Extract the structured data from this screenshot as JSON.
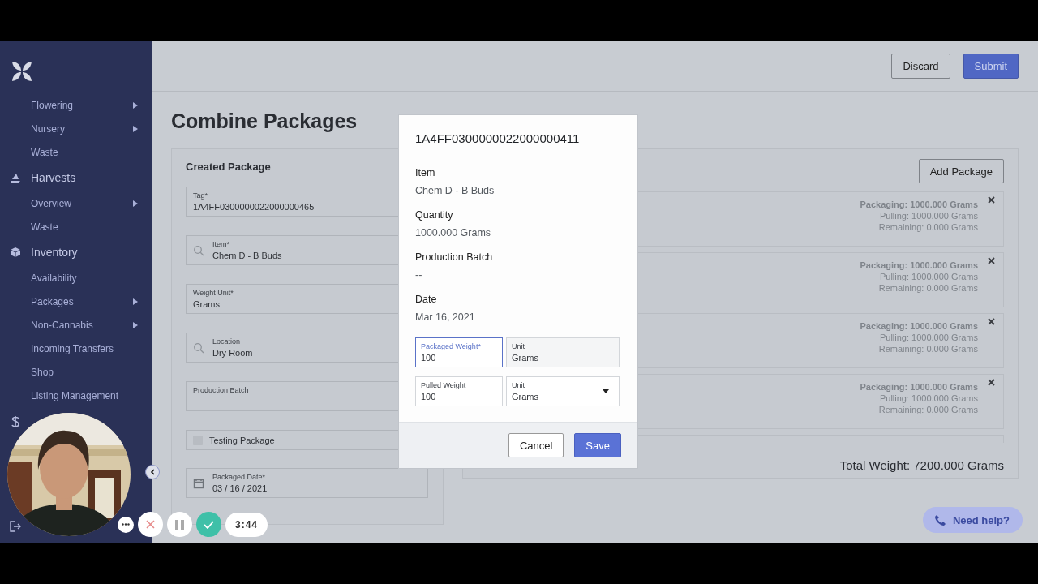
{
  "sidebar": {
    "items": [
      {
        "label": "Flowering",
        "kind": "link",
        "expandable": true
      },
      {
        "label": "Nursery",
        "kind": "link",
        "expandable": true
      },
      {
        "label": "Waste",
        "kind": "link",
        "expandable": false
      },
      {
        "label": "Harvests",
        "kind": "section"
      },
      {
        "label": "Overview",
        "kind": "link",
        "expandable": true
      },
      {
        "label": "Waste",
        "kind": "link",
        "expandable": false
      },
      {
        "label": "Inventory",
        "kind": "section"
      },
      {
        "label": "Availability",
        "kind": "link",
        "expandable": false
      },
      {
        "label": "Packages",
        "kind": "link",
        "expandable": true
      },
      {
        "label": "Non-Cannabis",
        "kind": "link",
        "expandable": true
      },
      {
        "label": "Incoming Transfers",
        "kind": "link",
        "expandable": false
      },
      {
        "label": "Shop",
        "kind": "link",
        "expandable": false
      },
      {
        "label": "Listing Management",
        "kind": "link",
        "expandable": false
      }
    ]
  },
  "header": {
    "buttons": [
      {
        "label": "Discard",
        "kind": "secondary"
      },
      {
        "label": "Submit",
        "kind": "primary"
      }
    ]
  },
  "title": "Combine Packages",
  "created_package": {
    "title": "Created Package",
    "fields": [
      {
        "kind": "field",
        "label": "Tag*",
        "value": "1A4FF0300000022000000465"
      },
      {
        "kind": "search",
        "label": "Item*",
        "value": "Chem D - B Buds"
      },
      {
        "kind": "field",
        "label": "Weight Unit*",
        "value": "Grams"
      },
      {
        "kind": "search",
        "label": "Location",
        "value": "Dry Room"
      },
      {
        "kind": "field",
        "label": "Production Batch"
      },
      {
        "kind": "checkbox",
        "label": "Testing Package",
        "checked": false
      },
      {
        "kind": "date",
        "label": "Packaged Date*",
        "value": "03 / 16 / 2021"
      }
    ]
  },
  "packages": {
    "add_button": "Add Package",
    "items": [
      {
        "packaging": "Packaging: 1000.000 Grams",
        "pulling": "Pulling: 1000.000 Grams",
        "remaining": "Remaining: 0.000 Grams"
      },
      {
        "packaging": "Packaging: 1000.000 Grams",
        "pulling": "Pulling: 1000.000 Grams",
        "remaining": "Remaining: 0.000 Grams"
      },
      {
        "packaging": "Packaging: 1000.000 Grams",
        "pulling": "Pulling: 1000.000 Grams",
        "remaining": "Remaining: 0.000 Grams"
      },
      {
        "packaging": "Packaging: 1000.000 Grams",
        "pulling": "Pulling: 1000.000 Grams",
        "remaining": "Remaining: 0.000 Grams"
      }
    ],
    "total": "Total Weight: 7200.000 Grams"
  },
  "modal": {
    "title": "1A4FF0300000022000000411",
    "details": [
      {
        "label": "Item",
        "value": "Chem D - B Buds"
      },
      {
        "label": "Quantity",
        "value": "1000.000 Grams"
      },
      {
        "label": "Production Batch",
        "value": "--"
      },
      {
        "label": "Date",
        "value": "Mar 16, 2021"
      }
    ],
    "fields": [
      {
        "kind": "input",
        "label": "Packaged Weight*",
        "value": "100",
        "focused": true
      },
      {
        "kind": "readonly",
        "label": "Unit",
        "value": "Grams",
        "focused": false
      },
      {
        "kind": "input",
        "label": "Pulled Weight",
        "value": "100",
        "focused": false
      },
      {
        "kind": "select",
        "label": "Unit",
        "value": "Grams",
        "focused": false
      }
    ],
    "buttons": [
      {
        "label": "Cancel",
        "kind": "secondary"
      },
      {
        "label": "Save",
        "kind": "primary"
      }
    ]
  },
  "help_button": "Need help?",
  "recorder": {
    "time": "3:44"
  }
}
